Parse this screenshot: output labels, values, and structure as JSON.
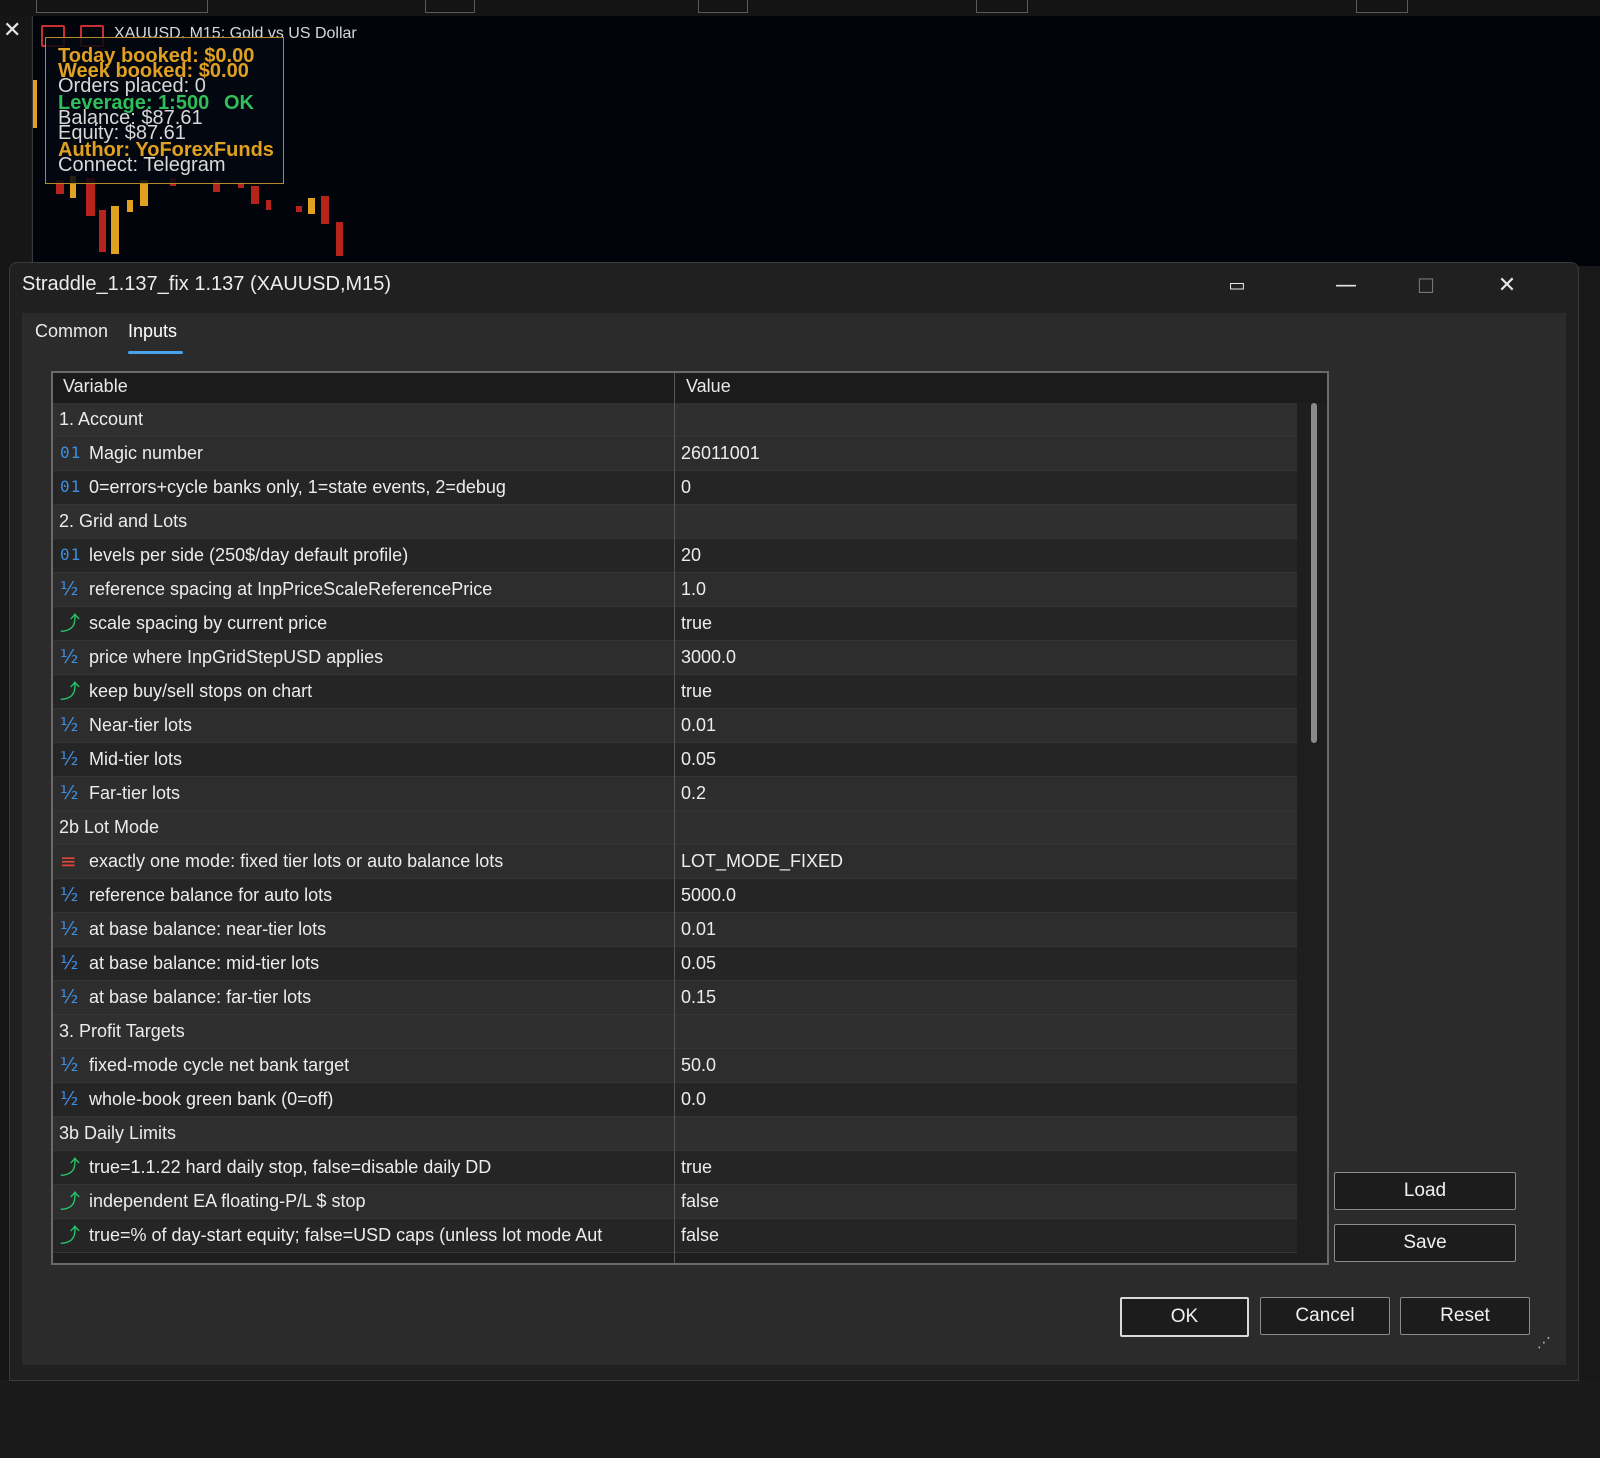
{
  "chart": {
    "symbol_label": "XAUUSD, M15:  Gold vs US Dollar",
    "overlay": {
      "today_booked": "Today booked: $0.00",
      "week_booked": "Week booked: $0.00",
      "orders_placed": "Orders placed: 0",
      "leverage": "Leverage: 1:500",
      "leverage_status": "OK",
      "balance": "Balance: $87.61",
      "equity": "Equity: $87.61",
      "author": "Author: YoForexFunds",
      "connect": "Connect: Telegram"
    }
  },
  "dialog": {
    "title": "Straddle_1.137_fix 1.137 (XAUUSD,M15)",
    "tabs": [
      "Common",
      "Inputs"
    ],
    "active_tab": "Inputs",
    "columns": {
      "variable": "Variable",
      "value": "Value"
    },
    "rows": [
      {
        "kind": "section",
        "label": "1. Account",
        "value": ""
      },
      {
        "kind": "int",
        "label": "Magic number",
        "value": "26011001"
      },
      {
        "kind": "int",
        "label": "0=errors+cycle banks only, 1=state events, 2=debug",
        "value": "0"
      },
      {
        "kind": "section",
        "label": "2. Grid and Lots",
        "value": ""
      },
      {
        "kind": "int",
        "label": "levels per side (250$/day default profile)",
        "value": "20"
      },
      {
        "kind": "double",
        "label": "reference spacing at InpPriceScaleReferencePrice",
        "value": "1.0"
      },
      {
        "kind": "bool",
        "label": "scale spacing by current price",
        "value": "true"
      },
      {
        "kind": "double",
        "label": "price where InpGridStepUSD applies",
        "value": "3000.0"
      },
      {
        "kind": "bool",
        "label": "keep buy/sell stops on chart",
        "value": "true"
      },
      {
        "kind": "double",
        "label": "Near-tier lots",
        "value": "0.01"
      },
      {
        "kind": "double",
        "label": "Mid-tier lots",
        "value": "0.05"
      },
      {
        "kind": "double",
        "label": "Far-tier lots",
        "value": "0.2"
      },
      {
        "kind": "section",
        "label": "2b Lot Mode",
        "value": ""
      },
      {
        "kind": "enum",
        "label": "exactly one mode: fixed tier lots or auto balance lots",
        "value": "LOT_MODE_FIXED"
      },
      {
        "kind": "double",
        "label": "reference balance for auto lots",
        "value": "5000.0"
      },
      {
        "kind": "double",
        "label": "at base balance: near-tier lots",
        "value": "0.01"
      },
      {
        "kind": "double",
        "label": "at base balance: mid-tier lots",
        "value": "0.05"
      },
      {
        "kind": "double",
        "label": "at base balance: far-tier lots",
        "value": "0.15"
      },
      {
        "kind": "section",
        "label": "3. Profit Targets",
        "value": ""
      },
      {
        "kind": "double",
        "label": "fixed-mode cycle net bank target",
        "value": "50.0"
      },
      {
        "kind": "double",
        "label": "whole-book green bank (0=off)",
        "value": "0.0"
      },
      {
        "kind": "section",
        "label": "3b Daily Limits",
        "value": ""
      },
      {
        "kind": "bool",
        "label": "true=1.1.22 hard daily stop, false=disable daily DD",
        "value": "true"
      },
      {
        "kind": "bool",
        "label": "independent EA floating-P/L $ stop",
        "value": "false"
      },
      {
        "kind": "bool",
        "label": "true=% of day-start equity; false=USD caps (unless lot mode Aut",
        "value": "false"
      }
    ],
    "side_buttons": {
      "load": "Load",
      "save": "Save"
    },
    "footer_buttons": {
      "ok": "OK",
      "cancel": "Cancel",
      "reset": "Reset"
    }
  },
  "colors": {
    "accent": "#4aa3e8",
    "overlay_gold": "#e0a020",
    "overlay_green": "#2fbf5a",
    "bool_icon": "#25c26a",
    "numeric_icon": "#3d8fe0",
    "enum_icon": "#e0453a"
  },
  "icons": {
    "int": "01",
    "double": "½",
    "bool": "⤴",
    "enum": "≡"
  }
}
